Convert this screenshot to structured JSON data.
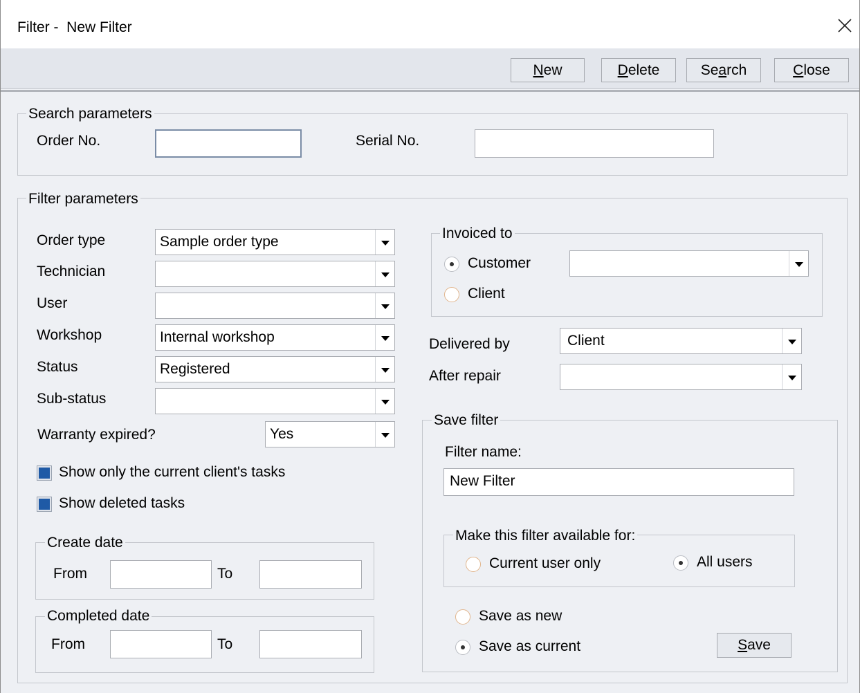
{
  "window": {
    "title": "Filter -  New Filter"
  },
  "toolbar": {
    "new": {
      "pre": "",
      "key": "N",
      "post": "ew"
    },
    "delete": {
      "pre": "",
      "key": "D",
      "post": "elete"
    },
    "search": {
      "pre": "Se",
      "key": "a",
      "post": "rch"
    },
    "close": {
      "pre": "",
      "key": "C",
      "post": "lose"
    }
  },
  "search_params": {
    "title": "Search parameters",
    "order_no": {
      "label": "Order No.",
      "value": ""
    },
    "serial_no": {
      "label": "Serial No.",
      "value": ""
    }
  },
  "filter_params": {
    "title": "Filter parameters",
    "order_type": {
      "label": "Order type",
      "value": "Sample order type"
    },
    "technician": {
      "label": "Technician",
      "value": ""
    },
    "user": {
      "label": "User",
      "value": ""
    },
    "workshop": {
      "label": "Workshop",
      "value": "Internal workshop"
    },
    "status": {
      "label": "Status",
      "value": "Registered"
    },
    "sub_status": {
      "label": "Sub-status",
      "value": ""
    },
    "warranty_expired": {
      "label": "Warranty expired?",
      "value": "Yes"
    },
    "show_current_client_tasks": {
      "label": "Show only the current client's tasks",
      "checked": true
    },
    "show_deleted_tasks": {
      "label": "Show deleted tasks",
      "checked": true
    },
    "create_date": {
      "title": "Create date",
      "from_label": "From",
      "to_label": "To",
      "from": "",
      "to": ""
    },
    "completed_date": {
      "title": "Completed date",
      "from_label": "From",
      "to_label": "To",
      "from": "",
      "to": ""
    }
  },
  "invoiced_to": {
    "title": "Invoiced to",
    "customer_label": "Customer",
    "client_label": "Client",
    "selected": "Customer",
    "customer_value": ""
  },
  "delivered_by": {
    "label": "Delivered by",
    "value": "Client"
  },
  "after_repair": {
    "label": "After repair",
    "value": ""
  },
  "save_filter": {
    "title": "Save filter",
    "name_label": "Filter name:",
    "name_value": "New Filter",
    "availability": {
      "title": "Make this filter available for:",
      "current_user_label": "Current user only",
      "all_users_label": "All users",
      "selected": "All users"
    },
    "save_as_new_label": "Save as new",
    "save_as_current_label": "Save as current",
    "selected_mode": "Save as current",
    "save_button": {
      "pre": "",
      "key": "S",
      "post": "ave"
    }
  },
  "colors": {
    "window_bg": "#eef0f4",
    "toolbar_bg": "#e3e6ec",
    "checkbox_fill": "#1f5aa6"
  },
  "icons": {
    "close": "close-icon",
    "combo": "chevron-down-icon"
  }
}
